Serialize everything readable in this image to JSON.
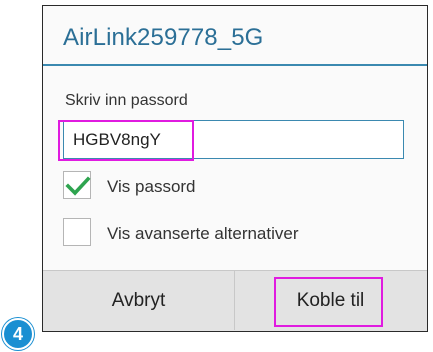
{
  "dialog": {
    "title": "AirLink259778_5G",
    "password_label": "Skriv inn passord",
    "password_value": "HGBV8ngY",
    "show_password": {
      "label": "Vis passord",
      "checked": true
    },
    "advanced_options": {
      "label": "Vis avanserte alternativer",
      "checked": false
    },
    "cancel_label": "Avbryt",
    "connect_label": "Koble til"
  },
  "step_badge": "4",
  "colors": {
    "accent": "#2b6f96",
    "highlight": "#e01be0",
    "check": "#2ea44f",
    "badge": "#1a8fd2"
  }
}
